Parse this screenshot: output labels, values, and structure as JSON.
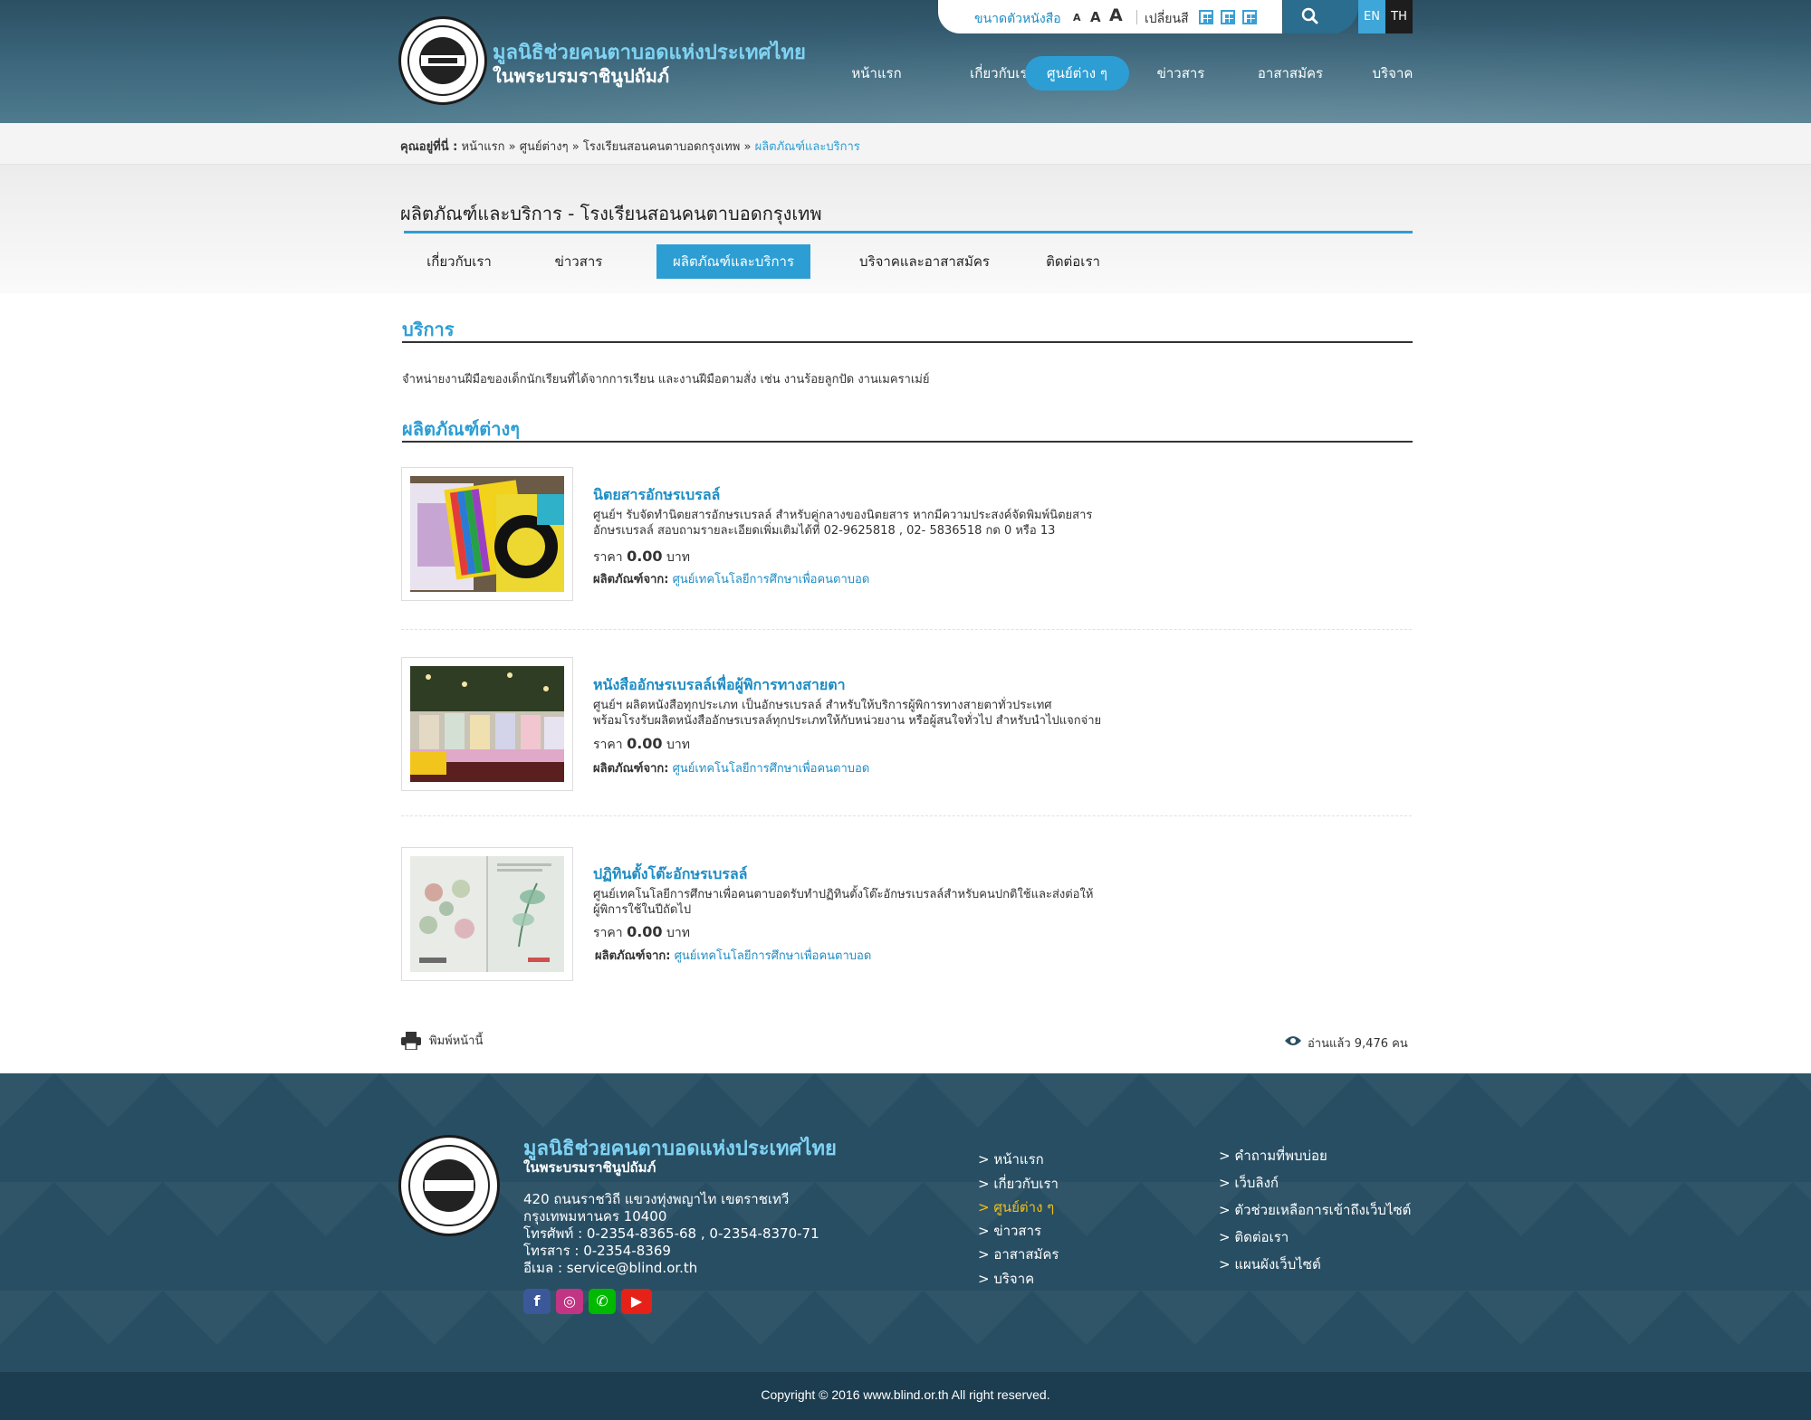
{
  "site": {
    "title_line1": "มูลนิธิช่วยคนตาบอดแห่งประเทศไทย",
    "title_line2": "ในพระบรมราชินูปถัมภ์"
  },
  "toolbar": {
    "font_size_label": "ขนาดตัวหนังสือ",
    "font_small": "A",
    "font_medium": "A",
    "font_large": "A",
    "color_label": "เปลี่ยนสี",
    "lang_en": "EN",
    "lang_th": "TH"
  },
  "nav": {
    "items": [
      {
        "label": "หน้าแรก"
      },
      {
        "label": "เกี่ยวกับเรา"
      },
      {
        "label": "ศูนย์ต่าง ๆ",
        "active": true
      },
      {
        "label": "ข่าวสาร"
      },
      {
        "label": "อาสาสมัคร"
      },
      {
        "label": "บริจาค"
      }
    ]
  },
  "breadcrumb": {
    "prefix": "คุณอยู่ที่นี่ :",
    "items": [
      "หน้าแรก",
      "ศูนย์ต่างๆ",
      "โรงเรียนสอนคนตาบอดกรุงเทพ",
      "ผลิตภัณฑ์และบริการ"
    ],
    "separator": "»"
  },
  "page": {
    "title": "ผลิตภัณฑ์และบริการ - โรงเรียนสอนคนตาบอดกรุงเทพ"
  },
  "subnav": {
    "items": [
      {
        "label": "เกี่ยวกับเรา"
      },
      {
        "label": "ข่าวสาร"
      },
      {
        "label": "ผลิตภัณฑ์และบริการ",
        "active": true
      },
      {
        "label": "บริจาคและอาสาสมัคร"
      },
      {
        "label": "ติดต่อเรา"
      }
    ]
  },
  "services": {
    "heading": "บริการ",
    "text": "จำหน่ายงานฝีมือของเด็กนักเรียนที่ได้จากการเรียน และงานฝีมือตามสั่ง  เช่น งานร้อยลูกปัด งานเมคราเม่ย์"
  },
  "products": {
    "heading": "ผลิตภัณฑ์ต่างๆ",
    "price_label": "ราคา",
    "currency": "บาท",
    "from_label": "ผลิตภัณฑ์จาก:",
    "items": [
      {
        "name": "นิตยสารอักษรเบรลล์",
        "desc_line1": "ศูนย์ฯ รับจัดทำนิตยสารอักษรเบรลล์ สำหรับคู่กลางของนิตยสาร หากมีความประสงค์จัดพิมพ์นิตยสาร",
        "desc_line2": "อักษรเบรลล์ สอบถามรายละเอียดเพิ่มเติมได้ที่ 02-9625818 , 02- 5836518 กด 0 หรือ 13",
        "price": "0.00",
        "from": "ศูนย์เทคโนโลยีการศึกษาเพื่อคนตาบอด"
      },
      {
        "name": "หนังสืออักษรเบรลล์เพื่อผู้พิการทางสายตา",
        "desc_line1": "ศูนย์ฯ ผลิตหนังสือทุกประเภท เป็นอักษรเบรลล์ สำหรับให้บริการผู้พิการทางสายตาทั่วประเทศ",
        "desc_line2": "พร้อมโรงรับผลิตหนังสืออักษรเบรลล์ทุกประเภทให้กับหน่วยงาน หรือผู้สนใจทั่วไป สำหรับนำไปแจกจ่าย",
        "price": "0.00",
        "from": "ศูนย์เทคโนโลยีการศึกษาเพื่อคนตาบอด"
      },
      {
        "name": "ปฏิทินตั้งโต๊ะอักษรเบรลล์",
        "desc_line1": "ศูนย์เทคโนโลยีการศึกษาเพื่อคนตาบอดรับทำปฏิทินตั้งโต๊ะอักษรเบรลล์สำหรับคนปกติใช้และส่งต่อให้",
        "desc_line2": "ผู้พิการใช้ในปีถัดไป",
        "price": "0.00",
        "from": "ศูนย์เทคโนโลยีการศึกษาเพื่อคนตาบอด"
      }
    ]
  },
  "page_footer": {
    "print_label": "พิมพ์หน้านี้",
    "views_label": "อ่านแล้ว 9,476 คน"
  },
  "footer": {
    "title_line1": "มูลนิธิช่วยคนตาบอดแห่งประเทศไทย",
    "title_line2": "ในพระบรมราชินูปถัมภ์",
    "address": [
      "420 ถนนราชวิถี แขวงทุ่งพญาไท เขตราชเทวี",
      "กรุงเทพมหานคร 10400",
      "โทรศัพท์ : 0-2354-8365-68 , 0-2354-8370-71",
      "โทรสาร : 0-2354-8369",
      "อีเมล : service@blind.or.th"
    ],
    "social": [
      {
        "icon": "facebook-icon",
        "glyph": "f",
        "color": "#3b5998"
      },
      {
        "icon": "instagram-icon",
        "glyph": "◎",
        "color": "#c13584"
      },
      {
        "icon": "line-icon",
        "glyph": "✆",
        "color": "#00b900"
      },
      {
        "icon": "youtube-icon",
        "glyph": "▶",
        "color": "#e62117"
      }
    ],
    "links_col1": [
      {
        "label": "> หน้าแรก"
      },
      {
        "label": "> เกี่ยวกับเรา"
      },
      {
        "label": "> ศูนย์ต่าง ๆ",
        "active": true
      },
      {
        "label": "> ข่าวสาร"
      },
      {
        "label": "> อาสาสมัคร"
      },
      {
        "label": "> บริจาค"
      }
    ],
    "links_col2": [
      {
        "label": "> คำถามที่พบบ่อย"
      },
      {
        "label": "> เว็บลิงก์"
      },
      {
        "label": "> ตัวช่วยเหลือการเข้าถึงเว็บไซต์"
      },
      {
        "label": "> ติดต่อเรา"
      },
      {
        "label": "> แผนผังเว็บไซต์"
      }
    ],
    "copyright": "Copyright © 2016 www.blind.or.th All right reserved."
  },
  "colors": {
    "accent": "#2d9ed3",
    "header": "#3a6479",
    "footer": "#284e63",
    "footer_active_link": "#f3c018"
  }
}
